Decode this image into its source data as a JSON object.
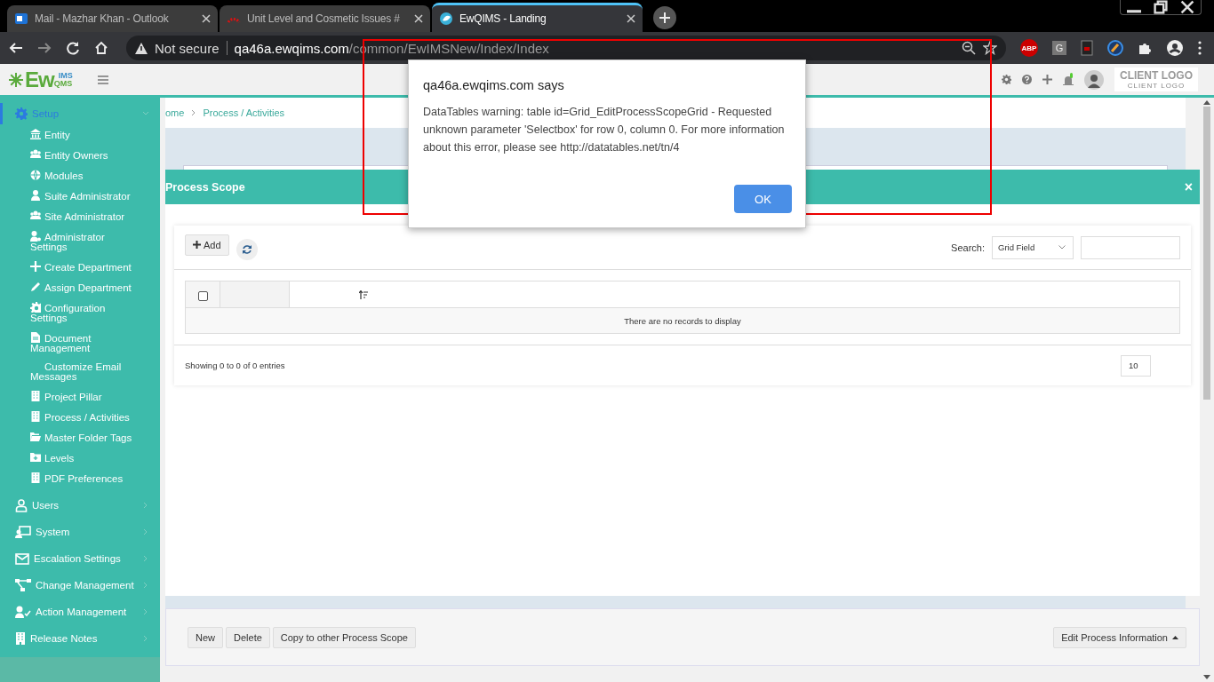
{
  "browser": {
    "tabs": [
      {
        "title": "Mail - Mazhar Khan - Outlook",
        "selected": false
      },
      {
        "title": "Unit Level and Cosmetic Issues #",
        "selected": false
      },
      {
        "title": "EwQIMS - Landing",
        "selected": true
      }
    ],
    "security": "Not secure",
    "url_host": "qa46a.ewqims.com",
    "url_path": "/common/EwIMSNew/Index/Index",
    "extension_badge": "ABP",
    "extension_letter": "G"
  },
  "header": {
    "logo": {
      "main": "Ew",
      "top": "IMS",
      "bottom": "QMS"
    },
    "client_logo": "CLIENT LOGO",
    "client_logo_sub": "CLIENT LOGO"
  },
  "sidebar": {
    "items": [
      {
        "label": "Setup",
        "selected": true,
        "expanded": true,
        "children": [
          {
            "label": "Entity"
          },
          {
            "label": "Entity Owners"
          },
          {
            "label": "Modules"
          },
          {
            "label": "Suite Administrator"
          },
          {
            "label": "Site Administrator"
          },
          {
            "label": "Administrator Settings"
          },
          {
            "label": "Create Department"
          },
          {
            "label": "Assign Department"
          },
          {
            "label": "Configuration Settings"
          },
          {
            "label": "Document Management"
          },
          {
            "label": "Customize Email Messages"
          },
          {
            "label": "Project Pillar"
          },
          {
            "label": "Process / Activities"
          },
          {
            "label": "Master Folder Tags"
          },
          {
            "label": "Levels"
          },
          {
            "label": "PDF Preferences"
          }
        ]
      },
      {
        "label": "Users",
        "selected": false,
        "expanded": false
      },
      {
        "label": "System",
        "selected": false,
        "expanded": false
      },
      {
        "label": "Escalation Settings",
        "selected": false,
        "expanded": false
      },
      {
        "label": "Change Management",
        "selected": false,
        "expanded": false
      },
      {
        "label": "Action Management",
        "selected": false,
        "expanded": false
      },
      {
        "label": "Release Notes",
        "selected": false,
        "expanded": false
      }
    ]
  },
  "breadcrumb": [
    "ome",
    "Process / Activities"
  ],
  "modal": {
    "title": "Process Scope",
    "close": "×",
    "add_button": "Add",
    "search_label": "Search:",
    "search_field": "Grid Field",
    "header_checkbox": {
      "checked": false
    },
    "empty_message": "There are no records to display",
    "info": "Showing 0 to 0 of 0 entries",
    "page_size": "10"
  },
  "footer": {
    "buttons": [
      "New",
      "Delete",
      "Copy to other Process Scope"
    ],
    "link": "Edit Process Information"
  },
  "alert": {
    "title": "qa46a.ewqims.com says",
    "message": "DataTables warning: table id=Grid_EditProcessScopeGrid - Requested unknown parameter 'Selectbox' for row 0, column 0. For more information about this error, please see http://datatables.net/tn/4",
    "button": "OK"
  }
}
